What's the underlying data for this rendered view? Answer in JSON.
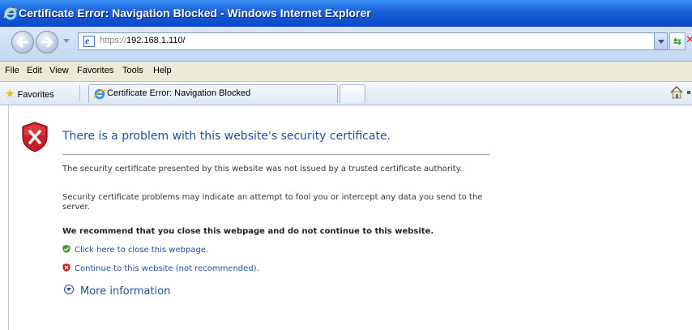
{
  "window": {
    "title": "Certificate Error: Navigation Blocked - Windows Internet Explorer"
  },
  "address_bar": {
    "url_protocol": "https://",
    "url_host": "192.168.1.110/"
  },
  "menu": {
    "items": [
      "File",
      "Edit",
      "View",
      "Favorites",
      "Tools",
      "Help"
    ]
  },
  "favorites_bar": {
    "favorites_label": "Favorites",
    "active_tab_label": "Certificate Error: Navigation Blocked"
  },
  "page": {
    "heading": "There is a problem with this website's security certificate.",
    "paragraph1": "The security certificate presented by this website was not issued by a trusted certificate authority.",
    "paragraph2": "Security certificate problems may indicate an attempt to fool you or intercept any data you send to the server.",
    "recommendation": "We recommend that you close this webpage and do not continue to this website.",
    "close_link": "Click here to close this webpage.",
    "continue_link": "Continue to this website (not recommended).",
    "more_info": "More information"
  },
  "colors": {
    "title_bar": "#1a5fd8",
    "link": "#1f4e99",
    "error_shield": "#c8202a"
  }
}
